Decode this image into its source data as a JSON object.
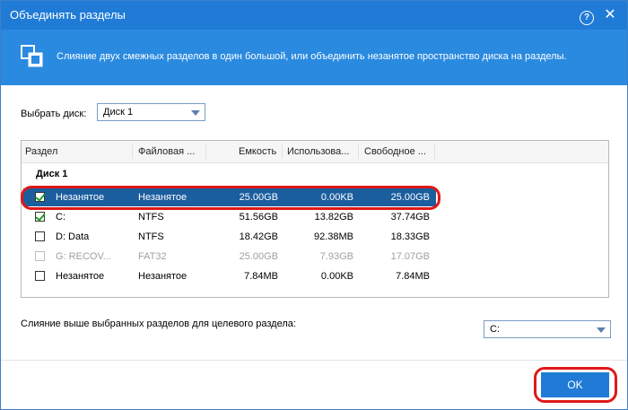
{
  "window": {
    "title": "Объединять разделы",
    "help_glyph": "?",
    "close_glyph": "✕"
  },
  "banner": {
    "description": "Слияние двух смежных разделов в один большой, или объединить незанятое пространство диска на разделы."
  },
  "disk_select": {
    "label": "Выбрать диск:",
    "value": "Диск 1"
  },
  "table": {
    "columns": [
      "Раздел",
      "Файловая ...",
      "Емкость",
      "Использова...",
      "Свободное ..."
    ],
    "group_label": "Диск 1",
    "rows": [
      {
        "name": "Незанятое",
        "fs": "Незанятое",
        "capacity": "25.00GB",
        "used": "0.00KB",
        "free": "25.00GB",
        "checked": true,
        "selected": true,
        "disabled": false
      },
      {
        "name": "C:",
        "fs": "NTFS",
        "capacity": "51.56GB",
        "used": "13.82GB",
        "free": "37.74GB",
        "checked": true,
        "selected": false,
        "disabled": false
      },
      {
        "name": "D: Data",
        "fs": "NTFS",
        "capacity": "18.42GB",
        "used": "92.38MB",
        "free": "18.33GB",
        "checked": false,
        "selected": false,
        "disabled": false
      },
      {
        "name": "G: RECOV...",
        "fs": "FAT32",
        "capacity": "25.00GB",
        "used": "7.93GB",
        "free": "17.07GB",
        "checked": false,
        "selected": false,
        "disabled": true
      },
      {
        "name": "Незанятое",
        "fs": "Незанятое",
        "capacity": "7.84MB",
        "used": "0.00KB",
        "free": "7.84MB",
        "checked": false,
        "selected": false,
        "disabled": false
      }
    ]
  },
  "merge_target": {
    "label": "Слияние выше выбранных разделов для целевого раздела:",
    "value": "C:"
  },
  "buttons": {
    "ok": "OK"
  },
  "colors": {
    "titlebar": "#1f7bd6",
    "banner": "#2a8ae0",
    "selected_row": "#1b5e9e",
    "highlight_ring": "#e01818",
    "check": "#1f9e25"
  }
}
